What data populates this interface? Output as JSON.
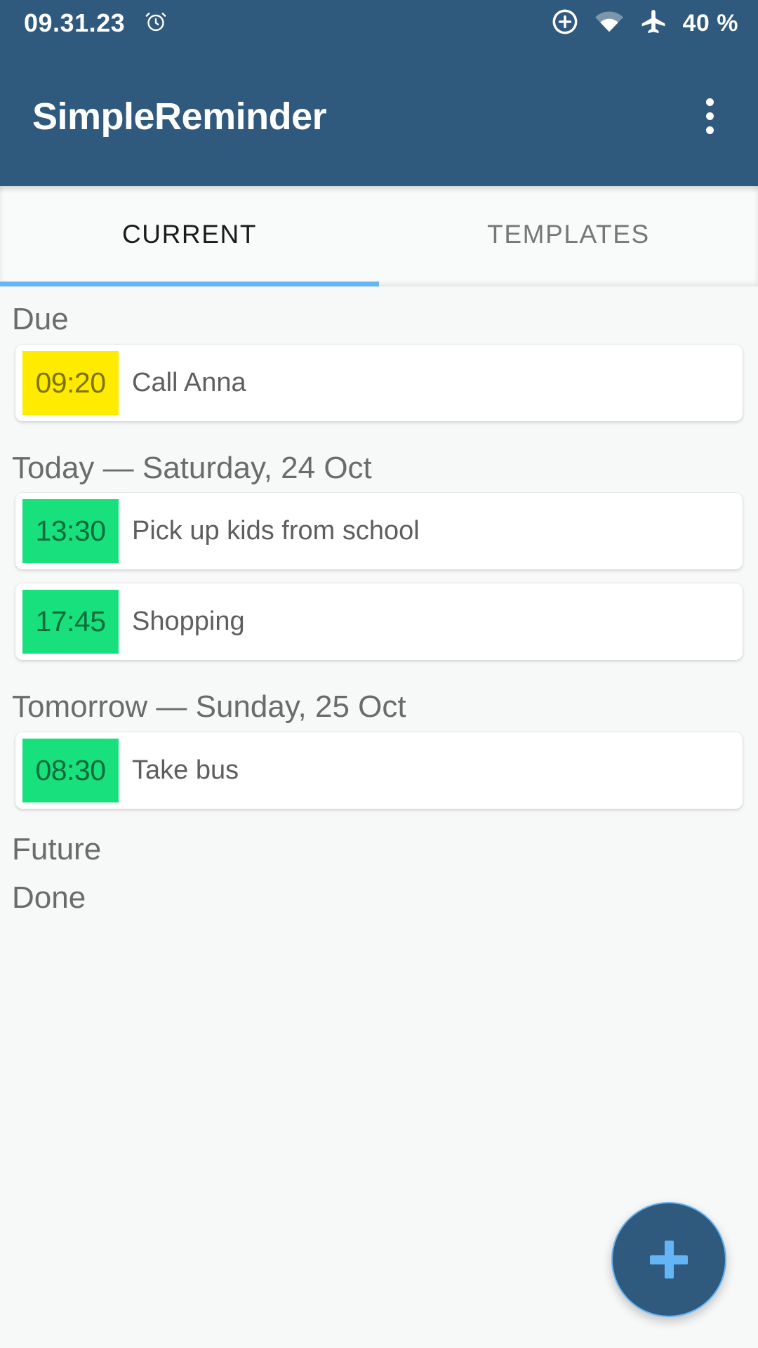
{
  "status_bar": {
    "time": "09.31.23",
    "alarm_icon": "alarm-clock-icon",
    "dnd_icon": "do-not-disturb-add-icon",
    "wifi_icon": "wifi-icon",
    "airplane_icon": "airplane-mode-icon",
    "battery": "40 %"
  },
  "app_bar": {
    "title": "SimpleReminder",
    "overflow_icon": "overflow-menu-icon",
    "background_color": "#2F5A7E"
  },
  "tabs": {
    "items": [
      {
        "label": "CURRENT",
        "active": true
      },
      {
        "label": "TEMPLATES",
        "active": false
      }
    ],
    "indicator_color": "#64B5F6"
  },
  "sections": [
    {
      "header": "Due",
      "items": [
        {
          "time": "09:20",
          "title": "Call Anna",
          "state": "due",
          "badge_color": "#FFEB00"
        }
      ]
    },
    {
      "header": "Today — Saturday, 24 Oct",
      "items": [
        {
          "time": "13:30",
          "title": "Pick up kids from school",
          "state": "upcoming",
          "badge_color": "#18E07C"
        },
        {
          "time": "17:45",
          "title": "Shopping",
          "state": "upcoming",
          "badge_color": "#18E07C"
        }
      ]
    },
    {
      "header": "Tomorrow — Sunday, 25 Oct",
      "items": [
        {
          "time": "08:30",
          "title": "Take bus",
          "state": "upcoming",
          "badge_color": "#18E07C"
        }
      ]
    },
    {
      "header": "Future",
      "items": []
    },
    {
      "header": "Done",
      "items": []
    }
  ],
  "fab": {
    "icon": "plus-icon",
    "label": "+",
    "background_color": "#2F5A7E",
    "icon_color": "#64B5F6"
  }
}
